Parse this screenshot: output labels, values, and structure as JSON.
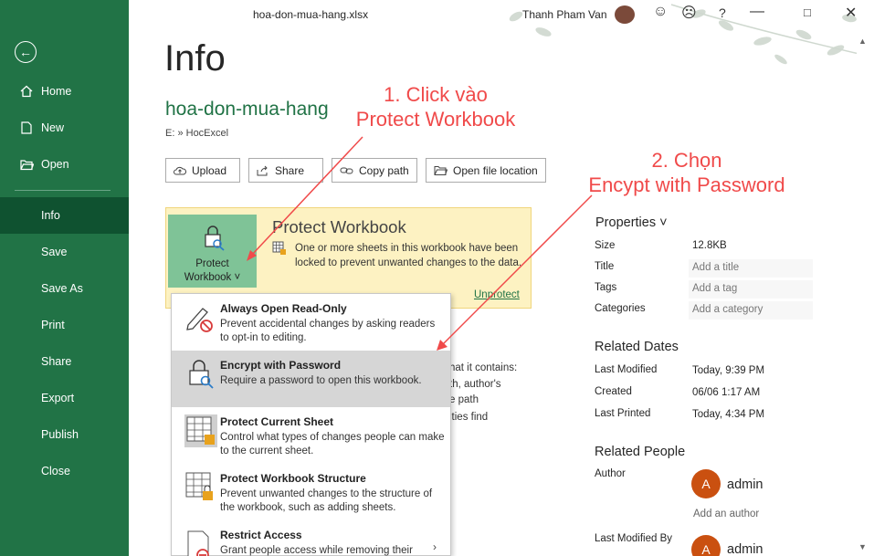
{
  "window": {
    "file_title": "hoa-don-mua-hang.xlsx",
    "user_name": "Thanh Pham Van"
  },
  "sidebar": {
    "items": [
      {
        "label": "Home",
        "icon": "home-icon"
      },
      {
        "label": "New",
        "icon": "new-document-icon"
      },
      {
        "label": "Open",
        "icon": "open-folder-icon"
      },
      {
        "label": "Info"
      },
      {
        "label": "Save"
      },
      {
        "label": "Save As"
      },
      {
        "label": "Print"
      },
      {
        "label": "Share"
      },
      {
        "label": "Export"
      },
      {
        "label": "Publish"
      },
      {
        "label": "Close"
      }
    ],
    "active": "Info",
    "color": "#217346",
    "active_color": "#0f5230"
  },
  "main": {
    "title": "Info",
    "doc_name": "hoa-don-mua-hang",
    "doc_path": "E: » HocExcel",
    "actions": {
      "upload": "Upload",
      "share": "Share",
      "copy_path": "Copy path",
      "open_location": "Open file location"
    },
    "protect": {
      "button_line1": "Protect",
      "button_line2": "Workbook ˅",
      "title": "Protect Workbook",
      "desc": "One or more sheets in this workbook have been locked to prevent unwanted changes to the data.",
      "unprotect": "Unprotect"
    },
    "behind_text": {
      "line1": "hat it contains:",
      "line2": "th, author's",
      "line3": "e path",
      "line4": "ities find"
    }
  },
  "menu": {
    "items": [
      {
        "title": "Always Open Read-Only",
        "desc": "Prevent accidental changes by asking readers to opt-in to editing.",
        "icon": "pencil-no-icon"
      },
      {
        "title": "Encrypt with Password",
        "desc": "Require a password to open this workbook.",
        "icon": "lock-key-icon"
      },
      {
        "title": "Protect Current Sheet",
        "desc": "Control what types of changes people can make to the current sheet.",
        "icon": "sheet-lock-icon"
      },
      {
        "title": "Protect Workbook Structure",
        "desc": "Prevent unwanted changes to the structure of the workbook, such as adding sheets.",
        "icon": "workbook-lock-icon"
      },
      {
        "title": "Restrict Access",
        "desc": "Grant people access while removing their",
        "icon": "restrict-access-icon"
      }
    ],
    "highlighted": "Encrypt with Password"
  },
  "properties": {
    "header": "Properties ˅",
    "size_label": "Size",
    "size_value": "12.8KB",
    "title_label": "Title",
    "title_placeholder": "Add a title",
    "tags_label": "Tags",
    "tags_placeholder": "Add a tag",
    "categories_label": "Categories",
    "categories_placeholder": "Add a category"
  },
  "related_dates": {
    "header": "Related Dates",
    "last_modified_label": "Last Modified",
    "last_modified_value": "Today, 9:39 PM",
    "created_label": "Created",
    "created_value": "06/06 1:17 AM",
    "last_printed_label": "Last Printed",
    "last_printed_value": "Today, 4:34 PM"
  },
  "related_people": {
    "header": "Related People",
    "author_label": "Author",
    "author_initial": "A",
    "author_name": "admin",
    "add_author": "Add an author",
    "last_modified_by_label": "Last Modified By",
    "modifier_initial": "A",
    "modifier_name": "admin"
  },
  "annotations": {
    "step1_line1": "1. Click vào",
    "step1_line2": "Protect Workbook",
    "step2_line1": "2. Chọn",
    "step2_line2": "Encypt with Password",
    "color": "#f04a4a"
  }
}
